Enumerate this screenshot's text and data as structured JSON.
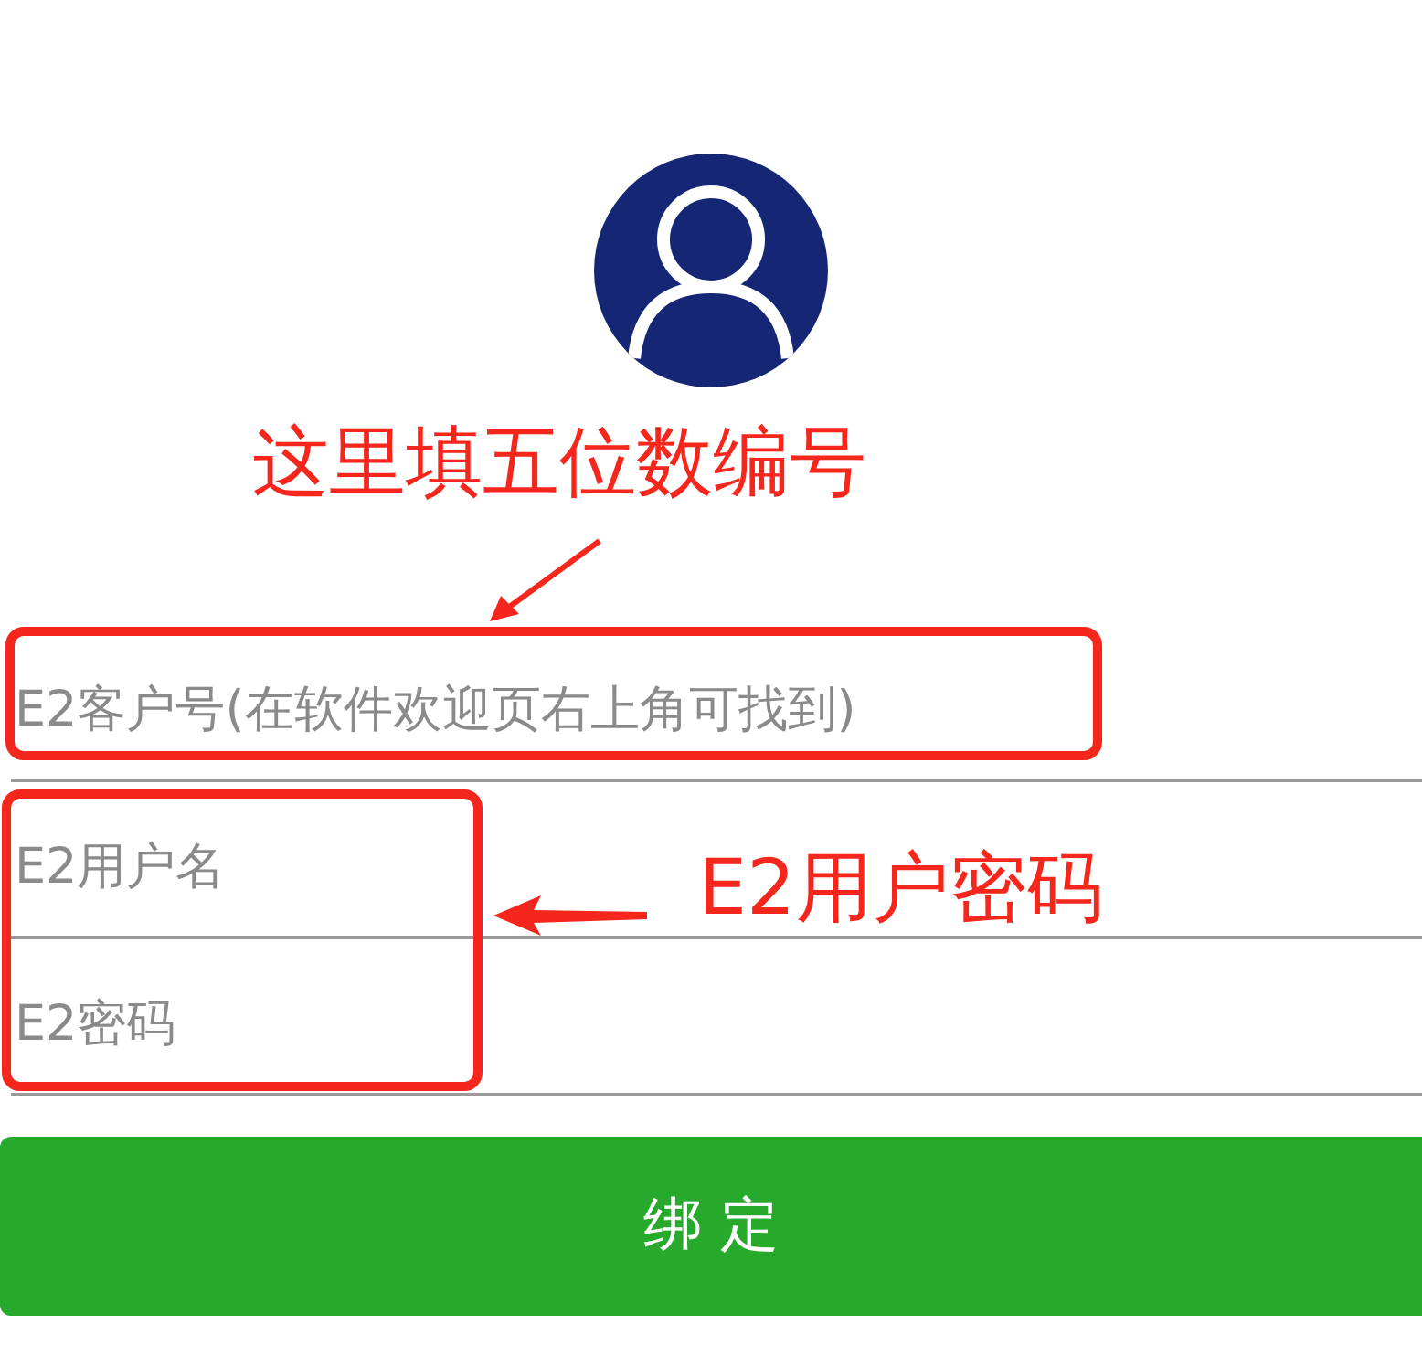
{
  "annotations": [
    {
      "kind": "callout",
      "text": "这里填五位数编号"
    },
    {
      "kind": "callout",
      "text": "E2用户密码"
    }
  ],
  "fields": [
    {
      "placeholder": "E2客户号(在软件欢迎页右上角可找到)"
    },
    {
      "placeholder": "E2用户名"
    },
    {
      "placeholder": "E2密码"
    }
  ],
  "button": {
    "label": "绑 定"
  }
}
